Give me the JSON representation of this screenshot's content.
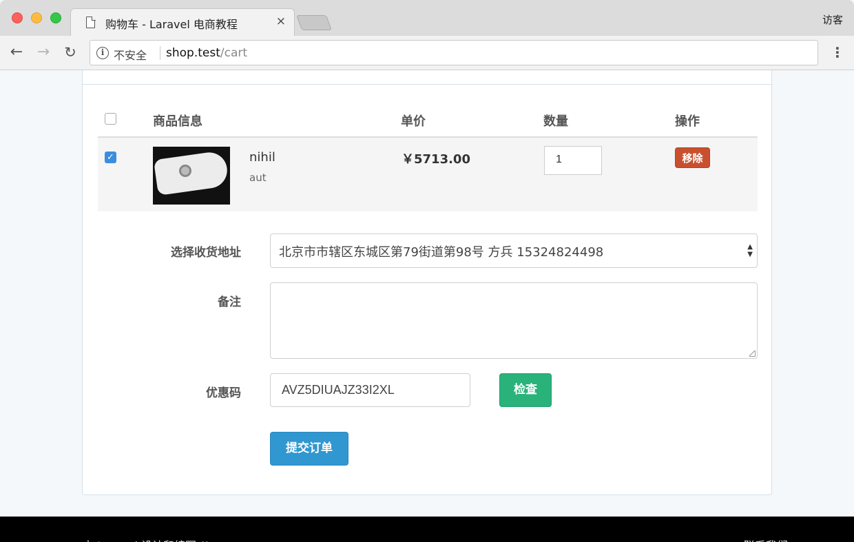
{
  "browser": {
    "tab_title": "购物车 - Laravel 电商教程",
    "tab_close": "×",
    "profile": "访客",
    "security_label": "不安全",
    "url_host": "shop.test",
    "url_path": "/cart"
  },
  "cart": {
    "columns": [
      "商品信息",
      "单价",
      "数量",
      "操作"
    ],
    "items": [
      {
        "checked": true,
        "name": "nihil",
        "sku": "aut",
        "price": "￥5713.00",
        "quantity": "1",
        "remove_label": "移除"
      }
    ]
  },
  "order_form": {
    "address_label": "选择收货地址",
    "address_value": "北京市市辖区东城区第79街道第98号 方兵 15324824498",
    "remark_label": "备注",
    "remark_value": "",
    "coupon_label": "优惠码",
    "coupon_value": "AVZ5DIUAJZ33I2XL",
    "check_button": "检查",
    "submit_button": "提交订单"
  },
  "footer": {
    "left": "由 Laravel 设计和编写 ♥",
    "right": "联系我们"
  },
  "colors": {
    "remove": "#c9502f",
    "check": "#2ab27b",
    "submit": "#3097d1",
    "checkbox": "#3b8de0"
  }
}
